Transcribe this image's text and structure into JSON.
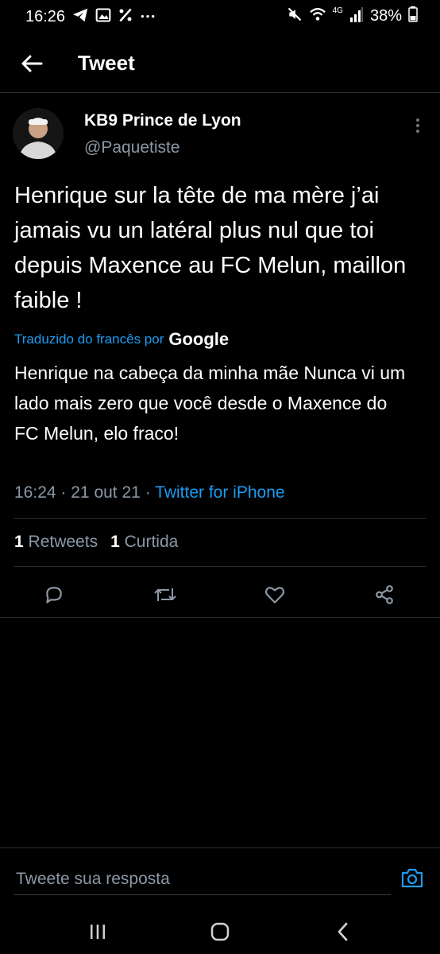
{
  "status_bar": {
    "time": "16:26",
    "left_icons": [
      "telegram-icon",
      "image-icon",
      "percent-icon",
      "more-dots-icon"
    ],
    "right_icons": [
      "mute-icon",
      "wifi-icon",
      "signal-icon",
      "battery-icon"
    ],
    "network": "4G",
    "battery": "38%"
  },
  "header": {
    "title": "Tweet"
  },
  "tweet": {
    "author_name": "KB9 Prince de Lyon",
    "author_handle": "@Paquetiste",
    "text": "Henrique sur la tête de ma mère j’ai jamais vu un latéral plus nul que toi depuis Maxence au FC Melun, maillon faible !",
    "translated_label": "Traduzido do francês por",
    "translator": "Google",
    "translated_text": "Henrique na cabeça da minha mãe Nunca vi um lado mais zero que você desde o Maxence do FC Melun, elo fraco!",
    "time": "16:24",
    "date": "21 out 21",
    "separator": "·",
    "source": "Twitter for iPhone",
    "retweets_count": "1",
    "retweets_label": "Retweets",
    "likes_count": "1",
    "likes_label": "Curtida"
  },
  "actions": [
    "reply-icon",
    "retweet-icon",
    "like-icon",
    "share-icon"
  ],
  "reply": {
    "placeholder": "Tweete sua resposta"
  },
  "nav": [
    "recents-icon",
    "home-icon",
    "back-icon"
  ],
  "colors": {
    "background": "#000000",
    "accent": "#1d9bf0",
    "muted": "#8b98a5",
    "divider": "#2a2f33"
  }
}
